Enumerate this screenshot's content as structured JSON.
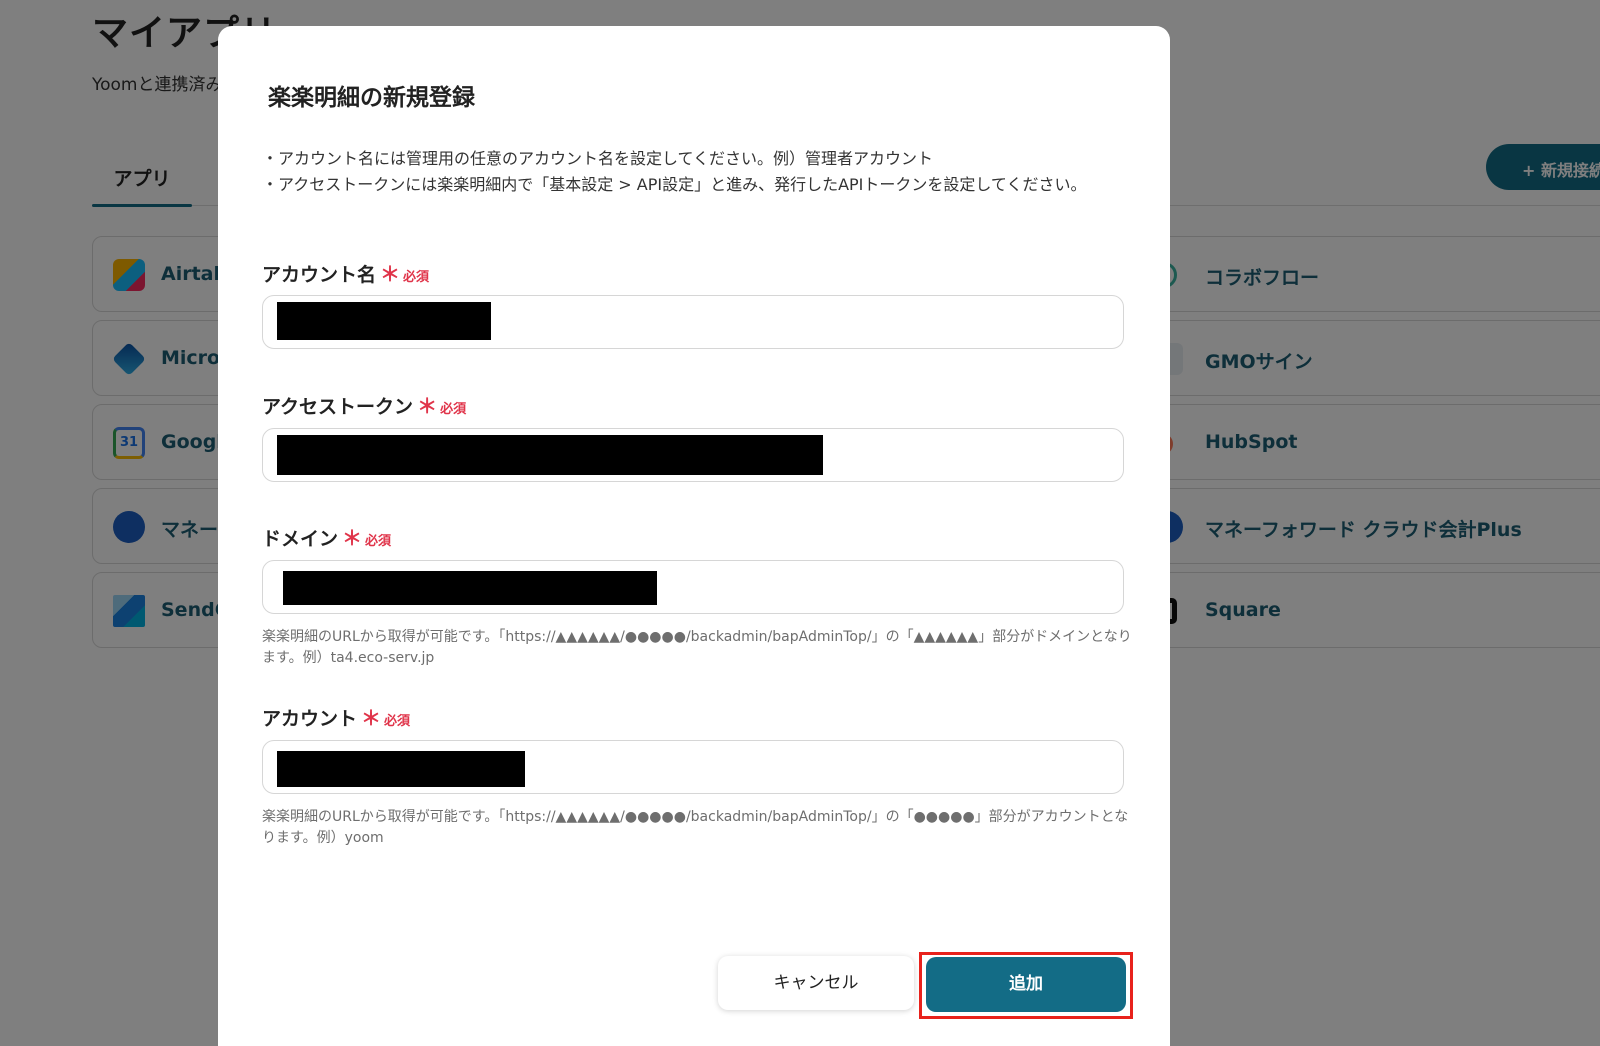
{
  "page": {
    "title": "マイアプリ",
    "subtitle": "Yoomと連携済み",
    "tab_apps": "アプリ",
    "new_connection": "+ 新規接続",
    "apps_left": [
      {
        "name": "Airtab",
        "icon": "airtable-icon"
      },
      {
        "name": "Micros",
        "icon": "microsoft-icon"
      },
      {
        "name": "Google",
        "icon": "google-calendar-icon"
      },
      {
        "name": "マネーフ",
        "icon": "moneyforward-icon"
      },
      {
        "name": "SendG",
        "icon": "sendgrid-icon"
      }
    ],
    "apps_right": [
      {
        "name": "コラボフロー",
        "icon": "collabflow-icon"
      },
      {
        "name": "GMOサイン",
        "icon": "gmo-sign-icon"
      },
      {
        "name": "HubSpot",
        "icon": "hubspot-icon"
      },
      {
        "name": "マネーフォワード クラウド会計Plus",
        "icon": "moneyforward-icon"
      },
      {
        "name": "Square",
        "icon": "square-icon"
      }
    ]
  },
  "modal": {
    "title": "楽楽明細の新規登録",
    "notes": [
      "・アカウント名には管理用の任意のアカウント名を設定してください。例）管理者アカウント",
      "・アクセストークンには楽楽明細内で「基本設定 > API設定」と進み、発行したAPIトークンを設定してください。"
    ],
    "required_star": "＊",
    "required_text": "必須",
    "fields": {
      "account_name": {
        "label": "アカウント名"
      },
      "access_token": {
        "label": "アクセストークン"
      },
      "domain": {
        "label": "ドメイン",
        "help": "楽楽明細のURLから取得が可能です。「https://▲▲▲▲▲▲/●●●●●/backadmin/bapAdminTop/」の「▲▲▲▲▲▲」部分がドメインとなります。例）ta4.eco-serv.jp"
      },
      "account": {
        "label": "アカウント",
        "help": "楽楽明細のURLから取得が可能です。「https://▲▲▲▲▲▲/●●●●●/backadmin/bapAdminTop/」の「●●●●●」部分がアカウントとなります。例）yoom"
      }
    },
    "cancel_label": "キャンセル",
    "add_label": "追加"
  },
  "colors": {
    "primary": "#136c86",
    "required": "#e0344a",
    "highlight": "#e8221c",
    "overlay": "rgba(0,0,0,0.5)"
  }
}
